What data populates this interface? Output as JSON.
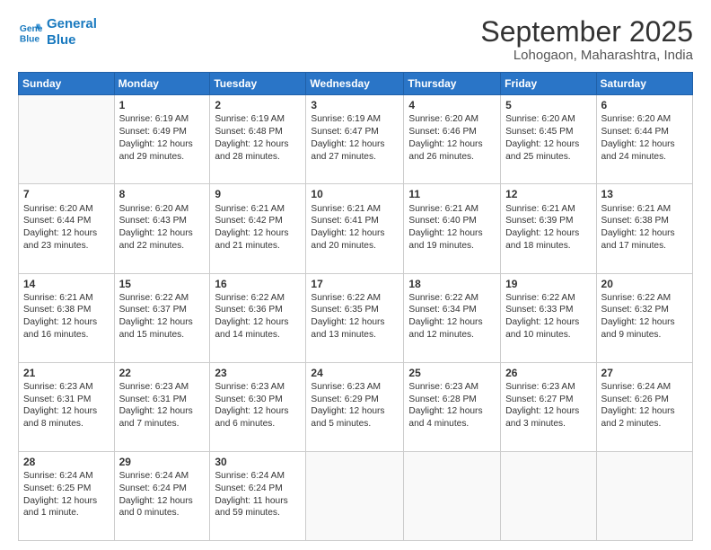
{
  "logo": {
    "line1": "General",
    "line2": "Blue"
  },
  "title": "September 2025",
  "subtitle": "Lohogaon, Maharashtra, India",
  "days_of_week": [
    "Sunday",
    "Monday",
    "Tuesday",
    "Wednesday",
    "Thursday",
    "Friday",
    "Saturday"
  ],
  "weeks": [
    [
      {
        "day": "",
        "info": ""
      },
      {
        "day": "1",
        "info": "Sunrise: 6:19 AM\nSunset: 6:49 PM\nDaylight: 12 hours\nand 29 minutes."
      },
      {
        "day": "2",
        "info": "Sunrise: 6:19 AM\nSunset: 6:48 PM\nDaylight: 12 hours\nand 28 minutes."
      },
      {
        "day": "3",
        "info": "Sunrise: 6:19 AM\nSunset: 6:47 PM\nDaylight: 12 hours\nand 27 minutes."
      },
      {
        "day": "4",
        "info": "Sunrise: 6:20 AM\nSunset: 6:46 PM\nDaylight: 12 hours\nand 26 minutes."
      },
      {
        "day": "5",
        "info": "Sunrise: 6:20 AM\nSunset: 6:45 PM\nDaylight: 12 hours\nand 25 minutes."
      },
      {
        "day": "6",
        "info": "Sunrise: 6:20 AM\nSunset: 6:44 PM\nDaylight: 12 hours\nand 24 minutes."
      }
    ],
    [
      {
        "day": "7",
        "info": "Sunrise: 6:20 AM\nSunset: 6:44 PM\nDaylight: 12 hours\nand 23 minutes."
      },
      {
        "day": "8",
        "info": "Sunrise: 6:20 AM\nSunset: 6:43 PM\nDaylight: 12 hours\nand 22 minutes."
      },
      {
        "day": "9",
        "info": "Sunrise: 6:21 AM\nSunset: 6:42 PM\nDaylight: 12 hours\nand 21 minutes."
      },
      {
        "day": "10",
        "info": "Sunrise: 6:21 AM\nSunset: 6:41 PM\nDaylight: 12 hours\nand 20 minutes."
      },
      {
        "day": "11",
        "info": "Sunrise: 6:21 AM\nSunset: 6:40 PM\nDaylight: 12 hours\nand 19 minutes."
      },
      {
        "day": "12",
        "info": "Sunrise: 6:21 AM\nSunset: 6:39 PM\nDaylight: 12 hours\nand 18 minutes."
      },
      {
        "day": "13",
        "info": "Sunrise: 6:21 AM\nSunset: 6:38 PM\nDaylight: 12 hours\nand 17 minutes."
      }
    ],
    [
      {
        "day": "14",
        "info": "Sunrise: 6:21 AM\nSunset: 6:38 PM\nDaylight: 12 hours\nand 16 minutes."
      },
      {
        "day": "15",
        "info": "Sunrise: 6:22 AM\nSunset: 6:37 PM\nDaylight: 12 hours\nand 15 minutes."
      },
      {
        "day": "16",
        "info": "Sunrise: 6:22 AM\nSunset: 6:36 PM\nDaylight: 12 hours\nand 14 minutes."
      },
      {
        "day": "17",
        "info": "Sunrise: 6:22 AM\nSunset: 6:35 PM\nDaylight: 12 hours\nand 13 minutes."
      },
      {
        "day": "18",
        "info": "Sunrise: 6:22 AM\nSunset: 6:34 PM\nDaylight: 12 hours\nand 12 minutes."
      },
      {
        "day": "19",
        "info": "Sunrise: 6:22 AM\nSunset: 6:33 PM\nDaylight: 12 hours\nand 10 minutes."
      },
      {
        "day": "20",
        "info": "Sunrise: 6:22 AM\nSunset: 6:32 PM\nDaylight: 12 hours\nand 9 minutes."
      }
    ],
    [
      {
        "day": "21",
        "info": "Sunrise: 6:23 AM\nSunset: 6:31 PM\nDaylight: 12 hours\nand 8 minutes."
      },
      {
        "day": "22",
        "info": "Sunrise: 6:23 AM\nSunset: 6:31 PM\nDaylight: 12 hours\nand 7 minutes."
      },
      {
        "day": "23",
        "info": "Sunrise: 6:23 AM\nSunset: 6:30 PM\nDaylight: 12 hours\nand 6 minutes."
      },
      {
        "day": "24",
        "info": "Sunrise: 6:23 AM\nSunset: 6:29 PM\nDaylight: 12 hours\nand 5 minutes."
      },
      {
        "day": "25",
        "info": "Sunrise: 6:23 AM\nSunset: 6:28 PM\nDaylight: 12 hours\nand 4 minutes."
      },
      {
        "day": "26",
        "info": "Sunrise: 6:23 AM\nSunset: 6:27 PM\nDaylight: 12 hours\nand 3 minutes."
      },
      {
        "day": "27",
        "info": "Sunrise: 6:24 AM\nSunset: 6:26 PM\nDaylight: 12 hours\nand 2 minutes."
      }
    ],
    [
      {
        "day": "28",
        "info": "Sunrise: 6:24 AM\nSunset: 6:25 PM\nDaylight: 12 hours\nand 1 minute."
      },
      {
        "day": "29",
        "info": "Sunrise: 6:24 AM\nSunset: 6:24 PM\nDaylight: 12 hours\nand 0 minutes."
      },
      {
        "day": "30",
        "info": "Sunrise: 6:24 AM\nSunset: 6:24 PM\nDaylight: 11 hours\nand 59 minutes."
      },
      {
        "day": "",
        "info": ""
      },
      {
        "day": "",
        "info": ""
      },
      {
        "day": "",
        "info": ""
      },
      {
        "day": "",
        "info": ""
      }
    ]
  ]
}
